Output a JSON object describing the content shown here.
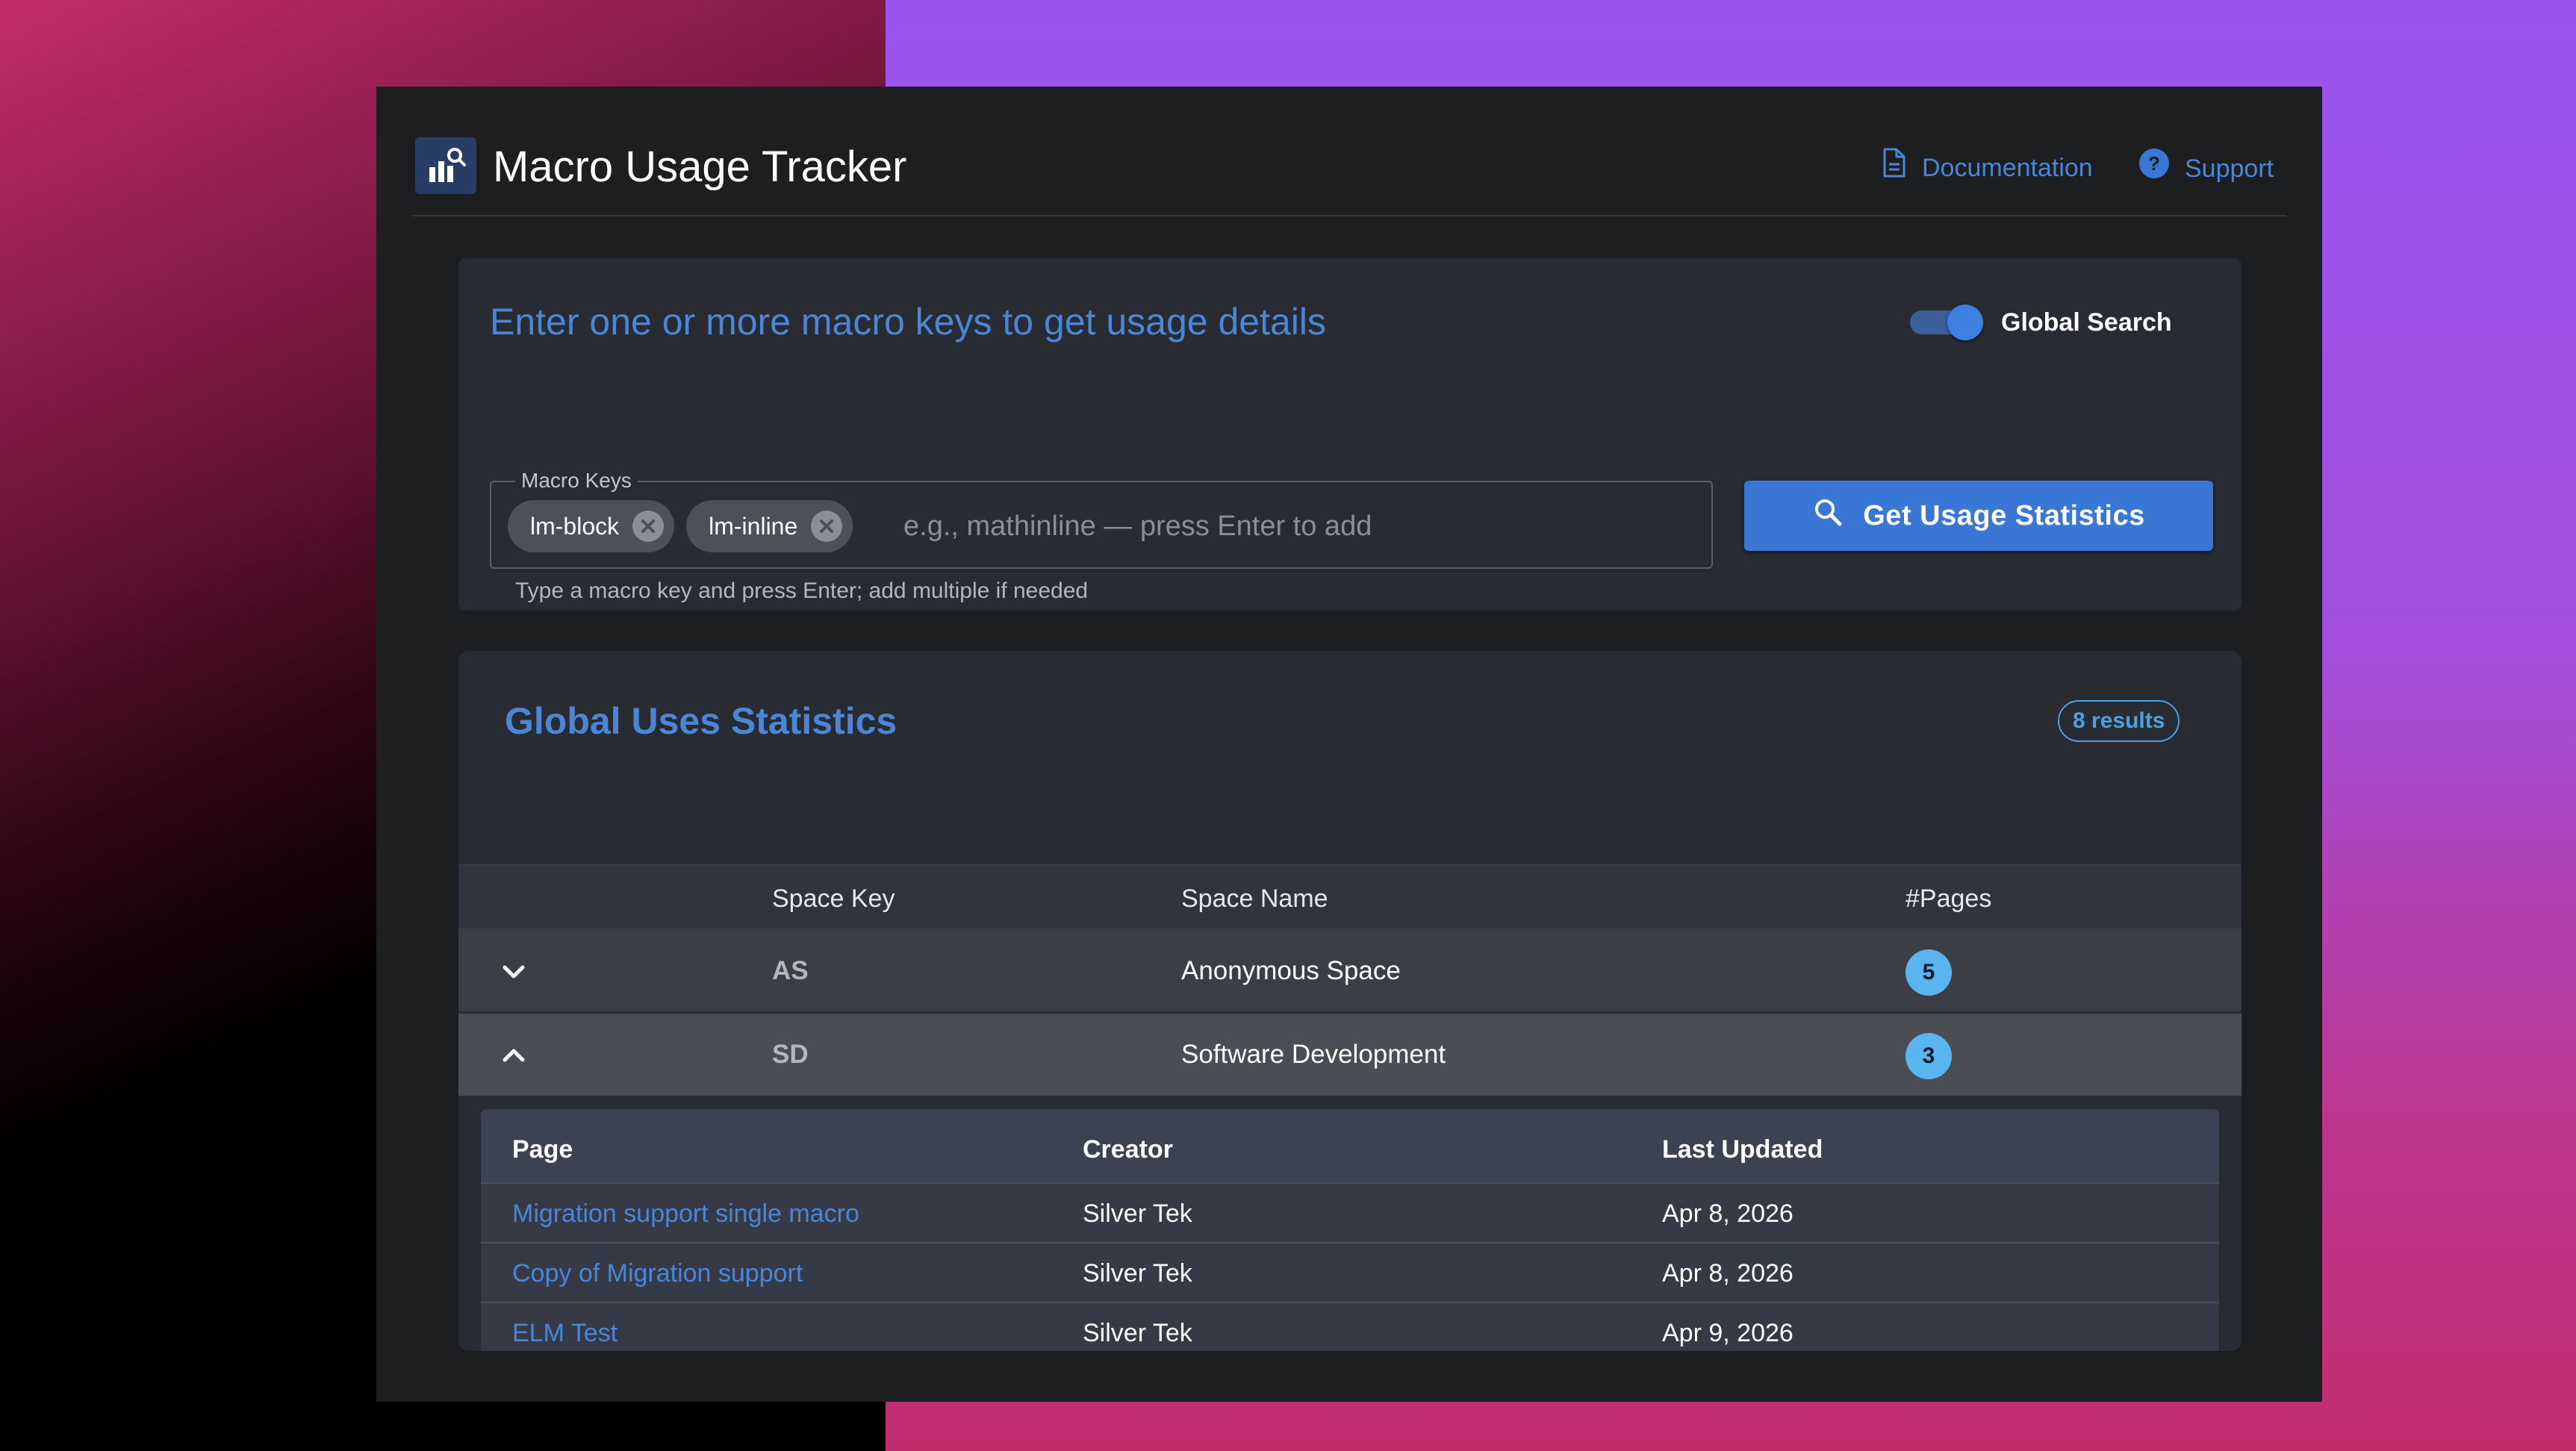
{
  "app": {
    "title": "Macro Usage Tracker",
    "accent_color": "#4a86d8",
    "logo_icon": "chart-search-icon"
  },
  "header_links": {
    "documentation": {
      "label": "Documentation",
      "icon": "document-icon"
    },
    "support": {
      "label": "Support",
      "icon": "help-circle-icon"
    }
  },
  "search": {
    "heading": "Enter one or more macro keys to get usage details",
    "global_search": {
      "label": "Global Search",
      "enabled": true
    },
    "field_label": "Macro Keys",
    "chips": [
      {
        "label": "lm-block"
      },
      {
        "label": "lm-inline"
      }
    ],
    "input_value": "",
    "placeholder": "e.g., mathinline — press Enter to add",
    "helper_text": "Type a macro key and press Enter; add multiple if needed",
    "button_label": "Get Usage Statistics",
    "button_icon": "search-icon"
  },
  "stats": {
    "title": "Global Uses Statistics",
    "results_badge": "8 results",
    "columns": [
      "Space Key",
      "Space Name",
      "#Pages"
    ],
    "rows": [
      {
        "key": "AS",
        "name": "Anonymous Space",
        "pages": "5",
        "expanded": false
      },
      {
        "key": "SD",
        "name": "Software Development",
        "pages": "3",
        "expanded": true
      }
    ],
    "detail": {
      "columns": [
        "Page",
        "Creator",
        "Last Updated"
      ],
      "rows": [
        {
          "page": "Migration support single macro",
          "creator": "Silver Tek",
          "updated": "Apr 8, 2026"
        },
        {
          "page": "Copy of Migration support",
          "creator": "Silver Tek",
          "updated": "Apr 8, 2026"
        },
        {
          "page": "ELM Test",
          "creator": "Silver Tek",
          "updated": "Apr 9, 2026"
        }
      ]
    }
  }
}
